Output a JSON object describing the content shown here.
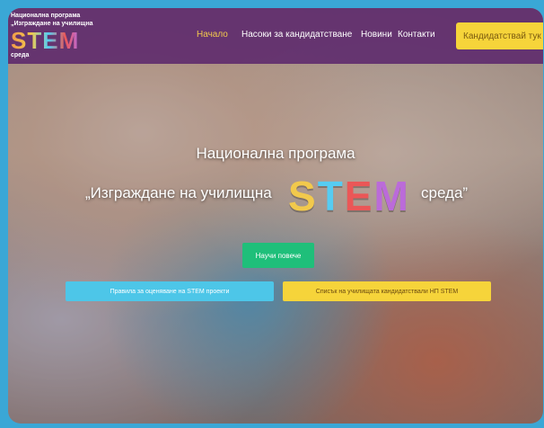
{
  "logo": {
    "line1": "Национална програма",
    "line2": "„Изграждане на училищна",
    "stem": "STEM",
    "line3": "среда"
  },
  "nav": {
    "items": [
      "Начало",
      "Насоки за кандидатстване",
      "Новини",
      "Контакти"
    ],
    "active": "Начало",
    "cta": "Кандидатствай тук"
  },
  "hero": {
    "pre_title": "Национална програма",
    "title_start": "„Изграждане на училищна",
    "stem": "STEM",
    "title_end": "среда”",
    "more_button": "Научи повече",
    "rules_button": "Правила за оценяване на STEM проекти",
    "list_button": "Списък на училищата кандидатствали НП STEM"
  },
  "colors": {
    "navbar": "#5f2d6e",
    "accent_yellow": "#f6d43a",
    "accent_blue": "#4dc6e8",
    "accent_green": "#1fbf7a"
  }
}
